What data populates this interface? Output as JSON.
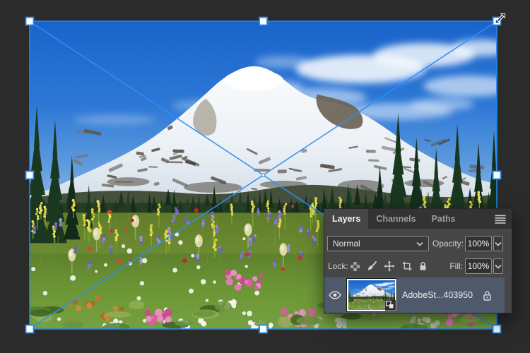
{
  "window": {
    "background": "#2b2b2b"
  },
  "transform": {
    "border_color": "#1e87f2",
    "handle_fill": "#fdfdfd",
    "handles": 8
  },
  "layers_panel": {
    "tabs": [
      {
        "label": "Layers",
        "active": true
      },
      {
        "label": "Channels",
        "active": false
      },
      {
        "label": "Paths",
        "active": false
      }
    ],
    "blend_mode": "Normal",
    "opacity_label": "Opacity:",
    "opacity_value": "100%",
    "lock_label": "Lock:",
    "fill_label": "Fill:",
    "fill_value": "100%",
    "layer": {
      "name": "AdobeSt...403950",
      "visible": true,
      "locked": true,
      "smart_object": true
    }
  },
  "colors": {
    "accent_blue": "#1e87f2",
    "selected_row": "#4e5a6b",
    "panel_body": "#464646"
  },
  "icons": {
    "panel_menu": "hamburger-lines",
    "visibility": "eye",
    "lock_transparent": "checkerboard",
    "lock_pixels": "brush",
    "lock_position": "move-arrows",
    "lock_artboard": "artboard-frame",
    "lock_all": "padlock",
    "layer_locked": "padlock-outline",
    "smart_object": "page-badge",
    "dropdown": "chevron-down",
    "resize_cursor": "diagonal-arrow"
  }
}
